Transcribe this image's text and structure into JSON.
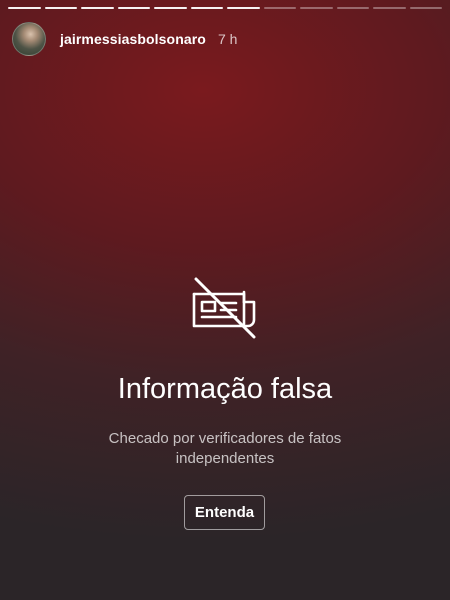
{
  "story": {
    "progress": {
      "total_segments": 12,
      "completed_segments": 7
    },
    "header": {
      "username": "jairmessiasbolsonaro",
      "time": "7 h"
    },
    "warning": {
      "icon": "newspaper-crossed-icon",
      "title": "Informação falsa",
      "subtitle": "Checado por verificadores de fatos independentes",
      "button_label": "Entenda"
    }
  },
  "colors": {
    "background_top": "#7a1a1e",
    "background_bottom": "#2b2528",
    "text": "#ffffff"
  }
}
